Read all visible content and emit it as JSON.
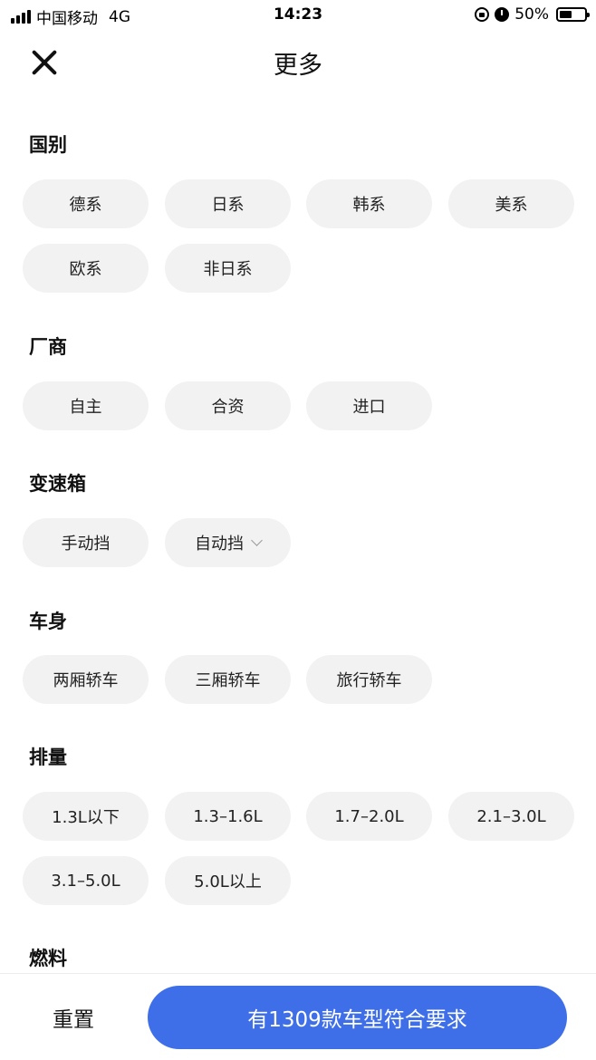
{
  "status_bar": {
    "carrier": "中国移动",
    "network": "4G",
    "time": "14:23",
    "battery": "50%",
    "icons": [
      "signal-icon",
      "lock-rotation-icon",
      "alarm-icon",
      "battery-icon"
    ]
  },
  "header": {
    "title": "更多",
    "close_icon": "close-icon"
  },
  "sections": {
    "country": {
      "title": "国别",
      "options": [
        "德系",
        "日系",
        "韩系",
        "美系",
        "欧系",
        "非日系"
      ]
    },
    "maker": {
      "title": "厂商",
      "options": [
        "自主",
        "合资",
        "进口"
      ]
    },
    "gearbox": {
      "title": "变速箱",
      "options": [
        "手动挡",
        "自动挡"
      ]
    },
    "body": {
      "title": "车身",
      "options": [
        "两厢轿车",
        "三厢轿车",
        "旅行轿车"
      ]
    },
    "displacement": {
      "title": "排量",
      "options": [
        "1.3L以下",
        "1.3–1.6L",
        "1.7–2.0L",
        "2.1–3.0L",
        "3.1–5.0L",
        "5.0L以上"
      ]
    },
    "fuel": {
      "title": "燃料"
    }
  },
  "bottom": {
    "reset_label": "重置",
    "submit_label": "有1309款车型符合要求"
  },
  "colors": {
    "accent": "#3f6fe8",
    "chip_bg": "#f2f2f2",
    "text": "#111111"
  }
}
